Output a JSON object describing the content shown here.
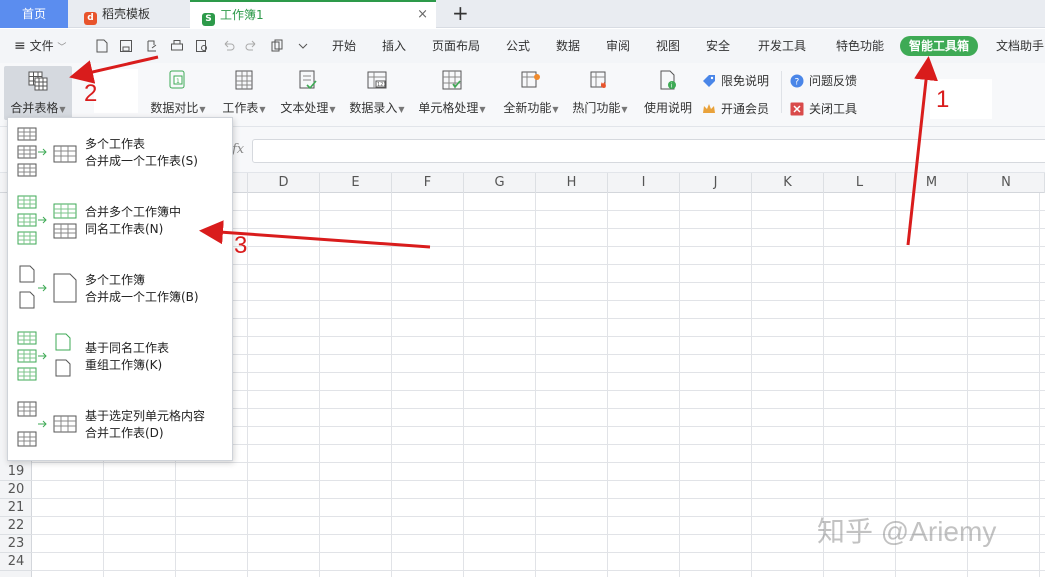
{
  "tabs": {
    "home": "首页",
    "template": "稻壳模板",
    "workbook": "工作簿1",
    "close": "×",
    "new": "+"
  },
  "menu": {
    "file": "文件",
    "items": [
      "开始",
      "插入",
      "页面布局",
      "公式",
      "数据",
      "审阅",
      "视图",
      "安全",
      "开发工具",
      "特色功能",
      "智能工具箱",
      "文档助手"
    ]
  },
  "ribbon": {
    "merge": "合并表格",
    "compare": "数据对比",
    "sheet": "工作表",
    "text": "文本处理",
    "entry": "数据录入",
    "cell": "单元格处理",
    "newfeatures": "全新功能",
    "hot": "热门功能",
    "guide": "使用说明",
    "disclaimer": "限免说明",
    "member": "开通会员",
    "feedback": "问题反馈",
    "close_tool": "关闭工具"
  },
  "formula": {
    "fx": "fx"
  },
  "columns": [
    "D",
    "E",
    "F",
    "G",
    "H",
    "I",
    "J",
    "K",
    "L",
    "M",
    "N"
  ],
  "rows": [
    "19",
    "20",
    "21",
    "22",
    "23",
    "24"
  ],
  "dropdown": [
    {
      "line1": "多个工作表",
      "line2": "合并成一个工作表(S)"
    },
    {
      "line1": "合并多个工作簿中",
      "line2": "同名工作表(N)"
    },
    {
      "line1": "多个工作簿",
      "line2": "合并成一个工作簿(B)"
    },
    {
      "line1": "基于同名工作表",
      "line2": "重组工作簿(K)"
    },
    {
      "line1": "基于选定列单元格内容",
      "line2": "合并工作表(D)"
    }
  ],
  "annotations": [
    "1",
    "2",
    "3"
  ],
  "watermark": "知乎 @Ariemy",
  "colors": {
    "accent_green": "#3eaa55",
    "home_tab": "#5b8def",
    "annotation_red": "#d91c1c"
  }
}
